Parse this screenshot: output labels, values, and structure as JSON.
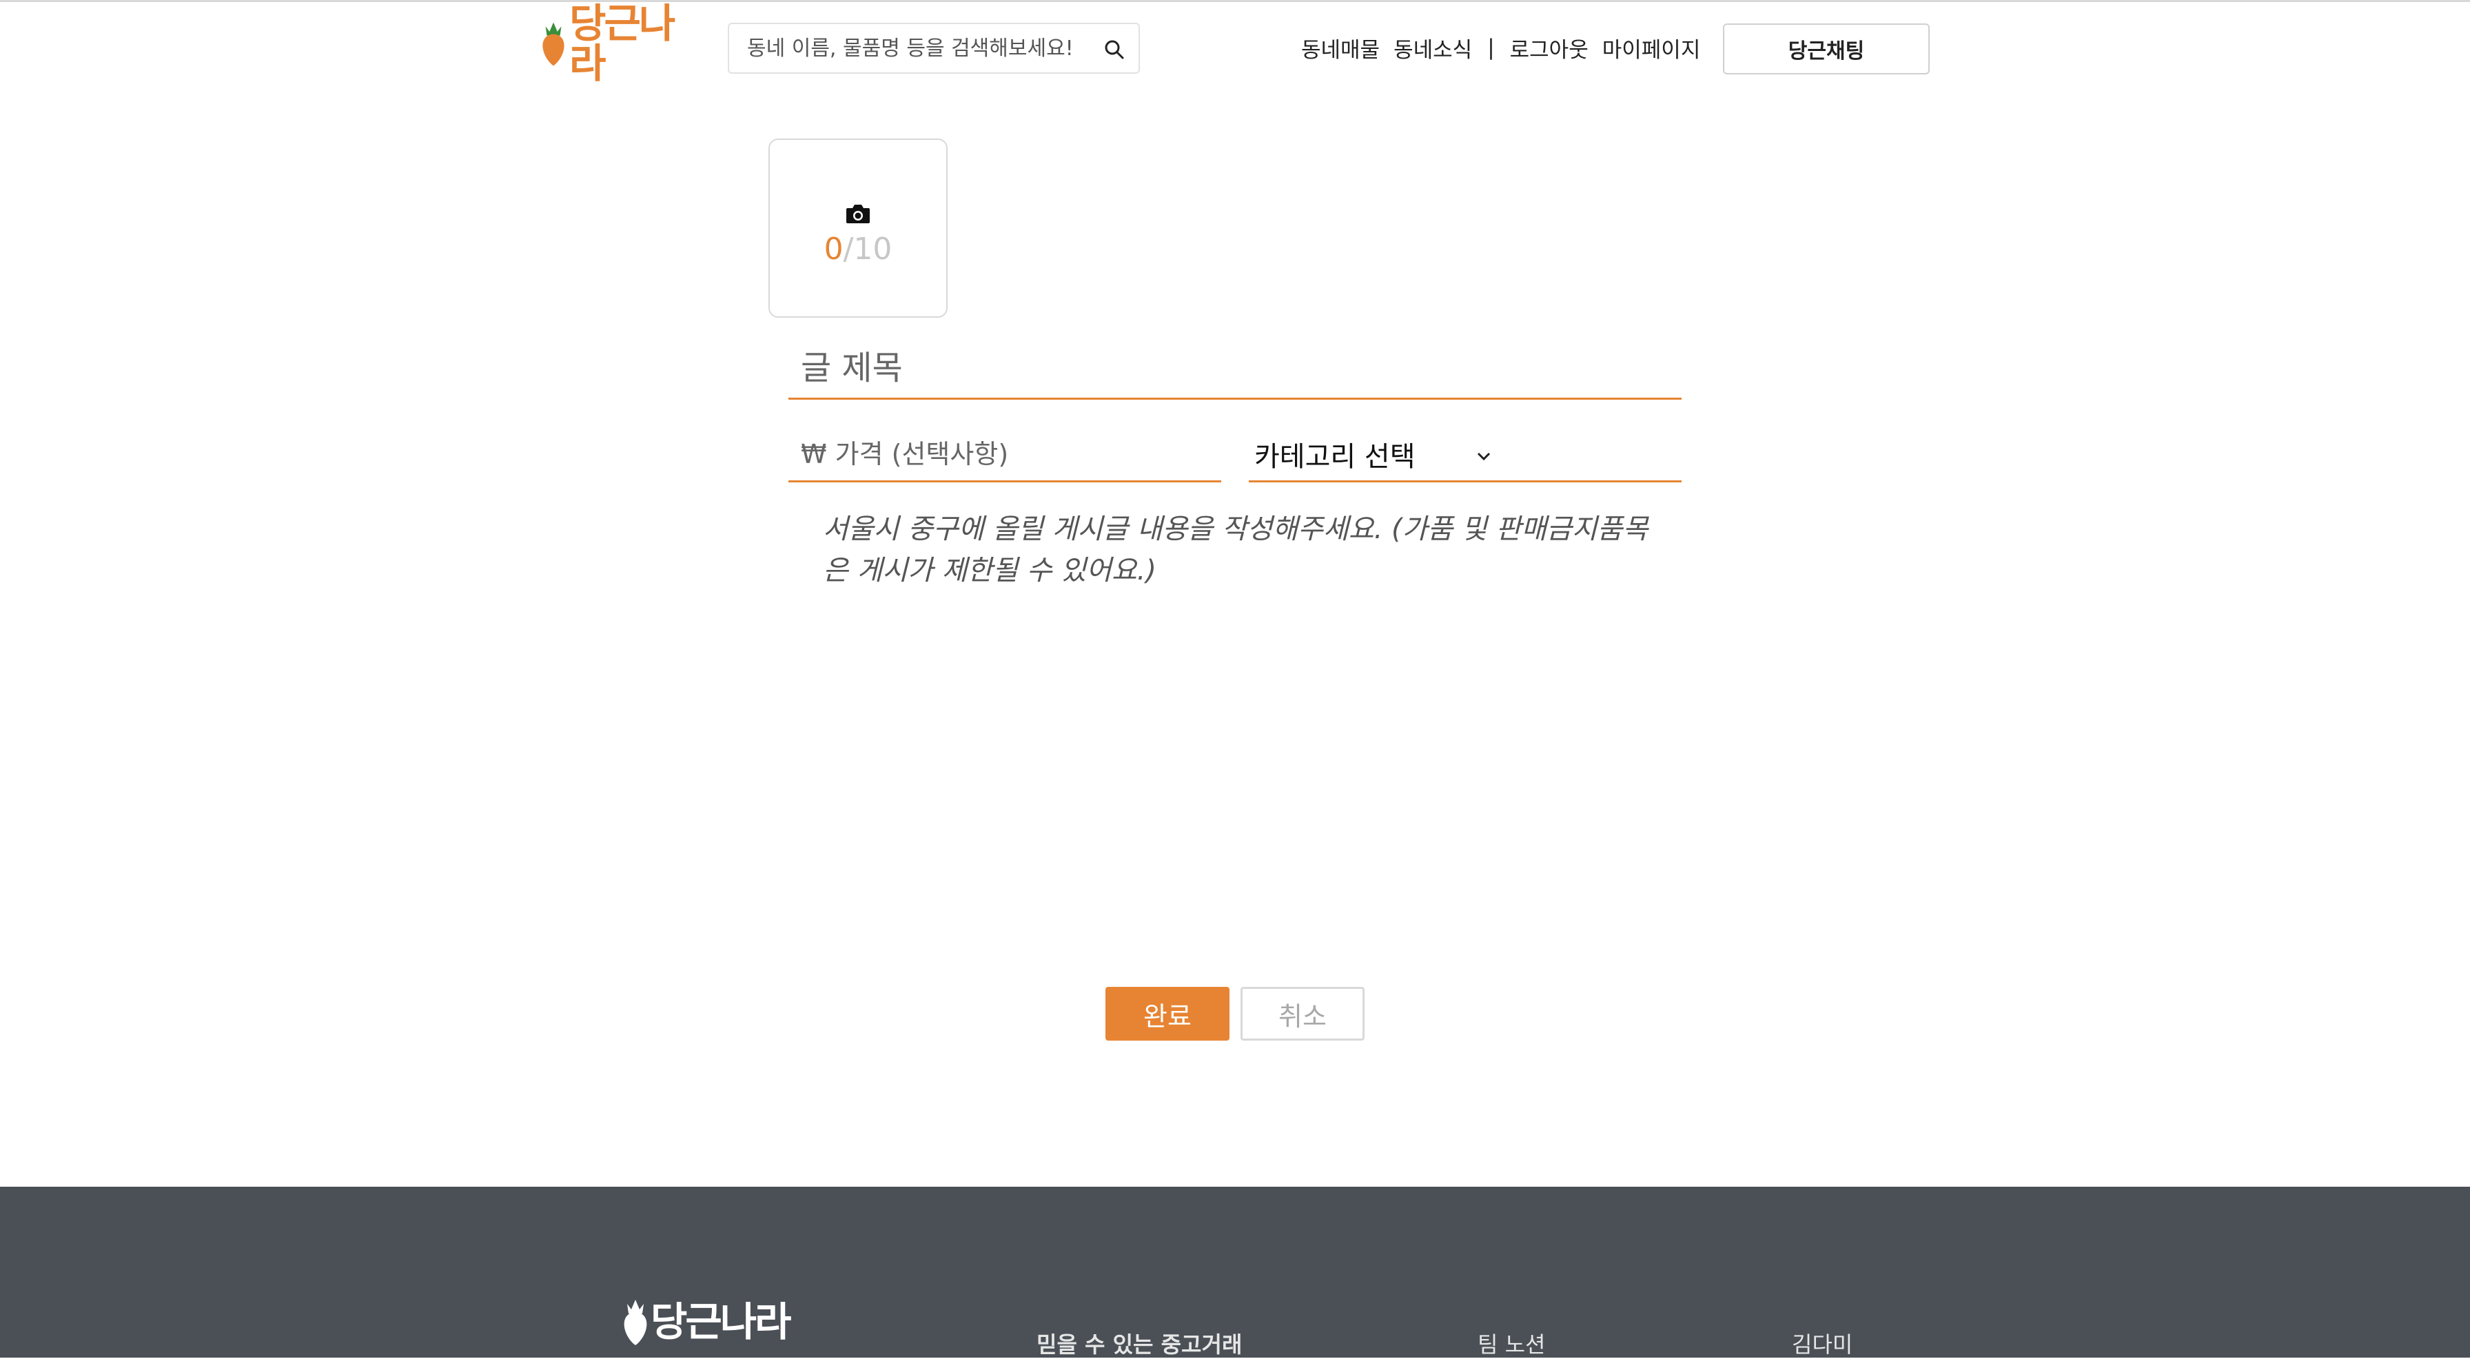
{
  "header": {
    "logo_text": "당근나라",
    "search_placeholder": "동네 이름, 물품명 등을 검색해보세요!",
    "nav": {
      "neighborhood_items": "동네매물",
      "neighborhood_news": "동네소식",
      "separator": "|",
      "logout": "로그아웃",
      "mypage": "마이페이지"
    },
    "chat_button": "당근채팅"
  },
  "photo_upload": {
    "current": "0",
    "max": "/10"
  },
  "form": {
    "title_placeholder": "글 제목",
    "price_placeholder": "₩ 가격 (선택사항)",
    "category_label": "카테고리 선택",
    "content_placeholder": "서울시 중구에 올릴 게시글 내용을 작성해주세요. (가품 및 판매금지품목은 게시가 제한될 수 있어요.)"
  },
  "actions": {
    "done": "완료",
    "cancel": "취소"
  },
  "footer": {
    "logo_text": "당근나라",
    "slogan": "믿을 수 있는 중고거래",
    "team": "팀 노션",
    "member": "김다미"
  },
  "colors": {
    "brand": "#e78433",
    "footer_bg": "#4b5057"
  }
}
